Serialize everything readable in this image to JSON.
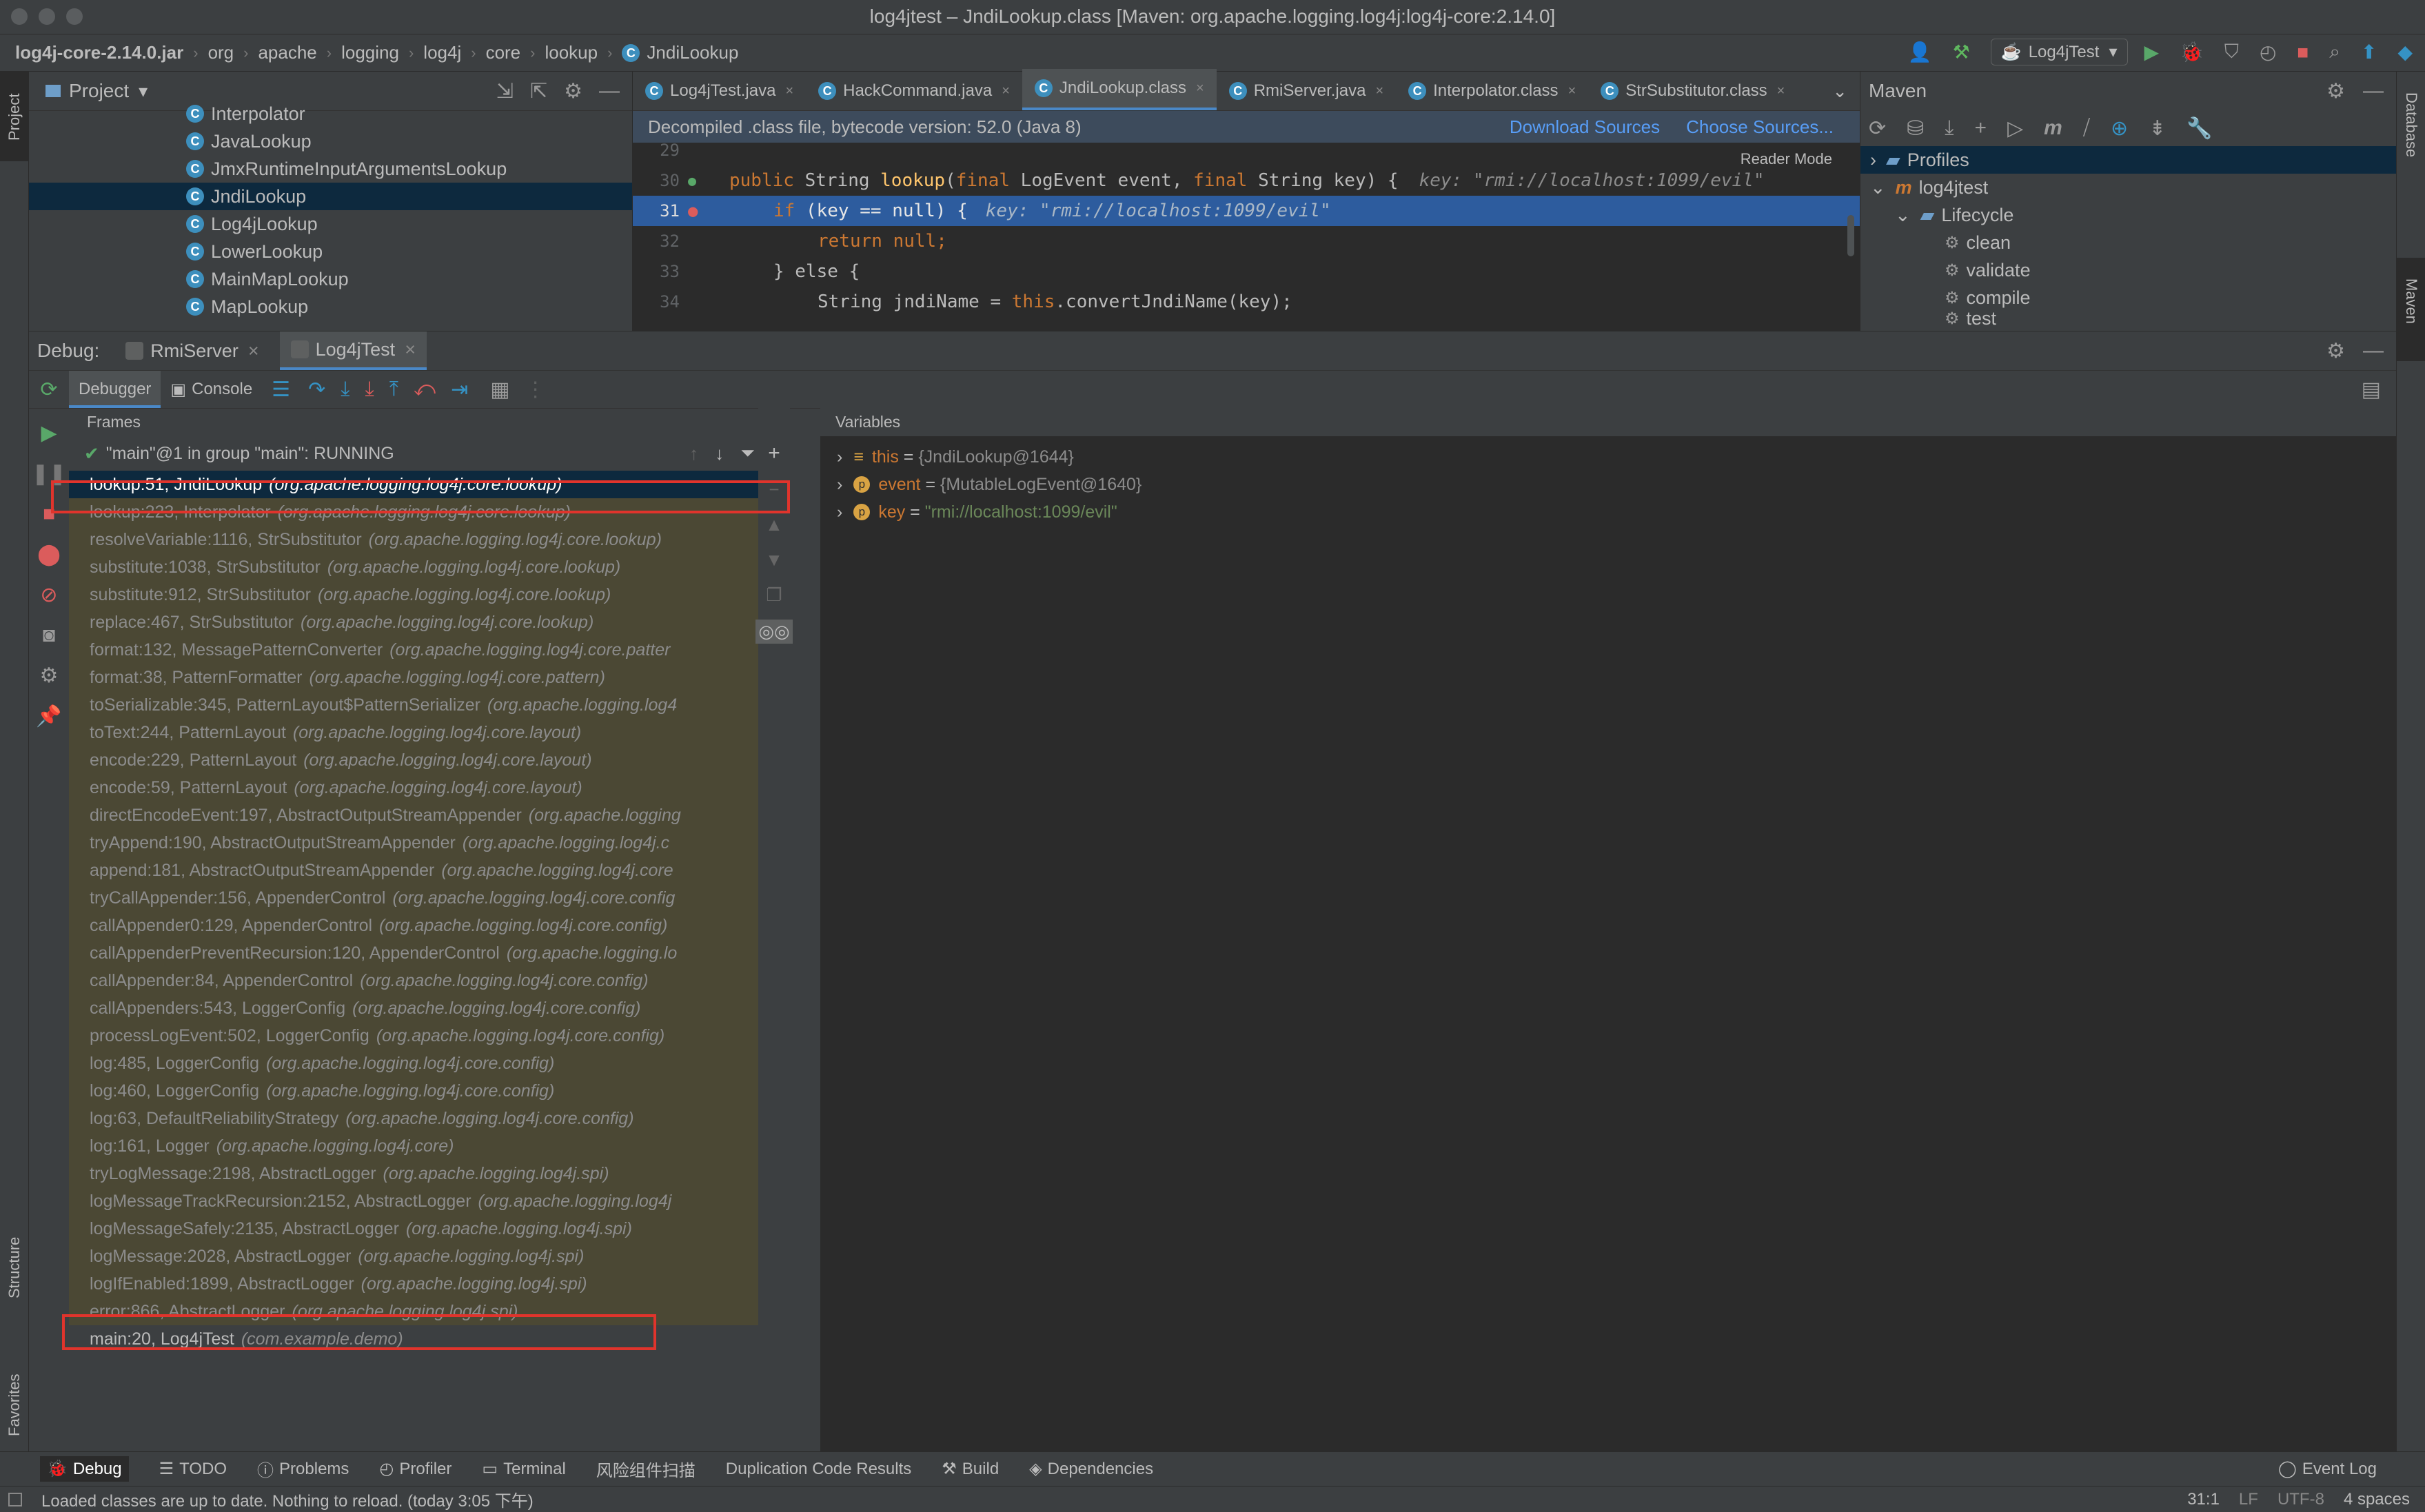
{
  "window": {
    "title": "log4jtest – JndiLookup.class [Maven: org.apache.logging.log4j:log4j-core:2.14.0]"
  },
  "breadcrumb": [
    "log4j-core-2.14.0.jar",
    "org",
    "apache",
    "logging",
    "log4j",
    "core",
    "lookup",
    "JndiLookup"
  ],
  "run_config": "Log4jTest",
  "project_panel": {
    "title": "Project",
    "items": [
      "Interpolator",
      "JavaLookup",
      "JmxRuntimeInputArgumentsLookup",
      "JndiLookup",
      "Log4jLookup",
      "LowerLookup",
      "MainMapLookup",
      "MapLookup"
    ],
    "selected": "JndiLookup"
  },
  "editor": {
    "tabs": [
      {
        "label": "Log4jTest.java",
        "active": false
      },
      {
        "label": "HackCommand.java",
        "active": false
      },
      {
        "label": "JndiLookup.class",
        "active": true
      },
      {
        "label": "RmiServer.java",
        "active": false
      },
      {
        "label": "Interpolator.class",
        "active": false
      },
      {
        "label": "StrSubstitutor.class",
        "active": false
      }
    ],
    "banner": "Decompiled .class file, bytecode version: 52.0 (Java 8)",
    "download_sources": "Download Sources",
    "choose_sources": "Choose Sources...",
    "reader_mode": "Reader Mode",
    "lines": {
      "l29": "29",
      "l30": "30",
      "l31": "31",
      "l32": "32",
      "l33": "33",
      "l34": "34"
    },
    "code": {
      "l30_kw1": "public",
      "l30_type": "String",
      "l30_fn": "lookup",
      "l30_rest1": "(",
      "l30_kw2": "final",
      "l30_rest2": "LogEvent event,",
      "l30_kw3": "final",
      "l30_rest3": "String key) {",
      "l30_hint": "key: \"rmi://localhost:1099/evil\"",
      "l31_kw": "if",
      "l31_rest": "(key == null) {",
      "l31_hint": "key: \"rmi://localhost:1099/evil\"",
      "l32_kw": "return",
      "l32_rest": "null;",
      "l33_rest": "} else {",
      "l34_rest1": "String jndiName =",
      "l34_kw": "this",
      "l34_rest2": ".convertJndiName(key);"
    }
  },
  "maven": {
    "title": "Maven",
    "tree": {
      "profiles": "Profiles",
      "project": "log4jtest",
      "lifecycle": "Lifecycle",
      "goals": [
        "clean",
        "validate",
        "compile",
        "test"
      ]
    }
  },
  "debug": {
    "label": "Debug:",
    "sessions": [
      "RmiServer",
      "Log4jTest"
    ],
    "tab_debugger": "Debugger",
    "tab_console": "Console",
    "frames_title": "Frames",
    "variables_title": "Variables",
    "thread": "\"main\"@1 in group \"main\": RUNNING",
    "frames": [
      {
        "method": "lookup:51, JndiLookup",
        "pkg": "(org.apache.logging.log4j.core.lookup)"
      },
      {
        "method": "lookup:223, Interpolator",
        "pkg": "(org.apache.logging.log4j.core.lookup)"
      },
      {
        "method": "resolveVariable:1116, StrSubstitutor",
        "pkg": "(org.apache.logging.log4j.core.lookup)"
      },
      {
        "method": "substitute:1038, StrSubstitutor",
        "pkg": "(org.apache.logging.log4j.core.lookup)"
      },
      {
        "method": "substitute:912, StrSubstitutor",
        "pkg": "(org.apache.logging.log4j.core.lookup)"
      },
      {
        "method": "replace:467, StrSubstitutor",
        "pkg": "(org.apache.logging.log4j.core.lookup)"
      },
      {
        "method": "format:132, MessagePatternConverter",
        "pkg": "(org.apache.logging.log4j.core.patter"
      },
      {
        "method": "format:38, PatternFormatter",
        "pkg": "(org.apache.logging.log4j.core.pattern)"
      },
      {
        "method": "toSerializable:345, PatternLayout$PatternSerializer",
        "pkg": "(org.apache.logging.log4"
      },
      {
        "method": "toText:244, PatternLayout",
        "pkg": "(org.apache.logging.log4j.core.layout)"
      },
      {
        "method": "encode:229, PatternLayout",
        "pkg": "(org.apache.logging.log4j.core.layout)"
      },
      {
        "method": "encode:59, PatternLayout",
        "pkg": "(org.apache.logging.log4j.core.layout)"
      },
      {
        "method": "directEncodeEvent:197, AbstractOutputStreamAppender",
        "pkg": "(org.apache.logging"
      },
      {
        "method": "tryAppend:190, AbstractOutputStreamAppender",
        "pkg": "(org.apache.logging.log4j.c"
      },
      {
        "method": "append:181, AbstractOutputStreamAppender",
        "pkg": "(org.apache.logging.log4j.core"
      },
      {
        "method": "tryCallAppender:156, AppenderControl",
        "pkg": "(org.apache.logging.log4j.core.config"
      },
      {
        "method": "callAppender0:129, AppenderControl",
        "pkg": "(org.apache.logging.log4j.core.config)"
      },
      {
        "method": "callAppenderPreventRecursion:120, AppenderControl",
        "pkg": "(org.apache.logging.lo"
      },
      {
        "method": "callAppender:84, AppenderControl",
        "pkg": "(org.apache.logging.log4j.core.config)"
      },
      {
        "method": "callAppenders:543, LoggerConfig",
        "pkg": "(org.apache.logging.log4j.core.config)"
      },
      {
        "method": "processLogEvent:502, LoggerConfig",
        "pkg": "(org.apache.logging.log4j.core.config)"
      },
      {
        "method": "log:485, LoggerConfig",
        "pkg": "(org.apache.logging.log4j.core.config)"
      },
      {
        "method": "log:460, LoggerConfig",
        "pkg": "(org.apache.logging.log4j.core.config)"
      },
      {
        "method": "log:63, DefaultReliabilityStrategy",
        "pkg": "(org.apache.logging.log4j.core.config)"
      },
      {
        "method": "log:161, Logger",
        "pkg": "(org.apache.logging.log4j.core)"
      },
      {
        "method": "tryLogMessage:2198, AbstractLogger",
        "pkg": "(org.apache.logging.log4j.spi)"
      },
      {
        "method": "logMessageTrackRecursion:2152, AbstractLogger",
        "pkg": "(org.apache.logging.log4j"
      },
      {
        "method": "logMessageSafely:2135, AbstractLogger",
        "pkg": "(org.apache.logging.log4j.spi)"
      },
      {
        "method": "logMessage:2028, AbstractLogger",
        "pkg": "(org.apache.logging.log4j.spi)"
      },
      {
        "method": "logIfEnabled:1899, AbstractLogger",
        "pkg": "(org.apache.logging.log4j.spi)"
      },
      {
        "method": "error:866, AbstractLogger",
        "pkg": "(org.apache.logging.log4j.spi)"
      },
      {
        "method": "main:20, Log4jTest",
        "pkg": "(com.example.demo)"
      }
    ],
    "variables": [
      {
        "name": "this",
        "value": "{JndiLookup@1644}"
      },
      {
        "name": "event",
        "value": "{MutableLogEvent@1640}"
      },
      {
        "name": "key",
        "value": "\"rmi://localhost:1099/evil\""
      }
    ]
  },
  "bottom_tabs": [
    "Debug",
    "TODO",
    "Problems",
    "Profiler",
    "Terminal",
    "风险组件扫描",
    "Duplication Code Results",
    "Build",
    "Dependencies"
  ],
  "event_log": "Event Log",
  "left_stripe": {
    "project": "Project",
    "structure": "Structure",
    "favorites": "Favorites"
  },
  "right_stripe": {
    "database": "Database",
    "maven": "Maven"
  },
  "status": {
    "message": "Loaded classes are up to date. Nothing to reload. (today 3:05 下午)",
    "position": "31:1",
    "line_sep": "LF",
    "encoding": "UTF-8",
    "indent": "4 spaces"
  },
  "colors": {
    "accent": "#4a88c7",
    "highlight": "#e0342c",
    "selection": "#0d293e"
  }
}
